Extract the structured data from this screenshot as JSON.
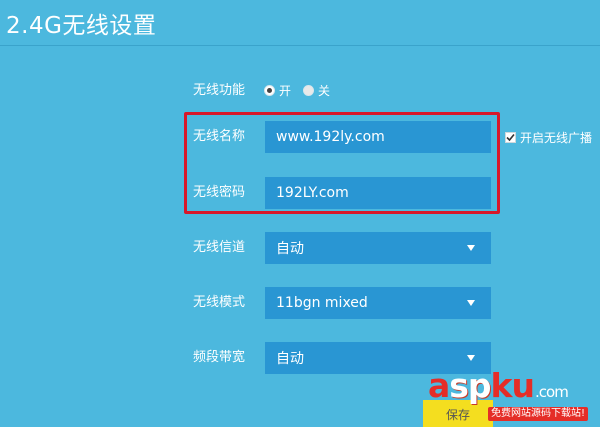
{
  "header": {
    "title": "2.4G无线设置"
  },
  "wireless_function": {
    "label": "无线功能",
    "on_label": "开",
    "off_label": "关",
    "selected": "开"
  },
  "ssid": {
    "label": "无线名称",
    "value": "www.192ly.com"
  },
  "broadcast": {
    "label": "开启无线广播",
    "checked": true
  },
  "password": {
    "label": "无线密码",
    "value": "192LY.com"
  },
  "channel": {
    "label": "无线信道",
    "value": "自动"
  },
  "mode": {
    "label": "无线模式",
    "value": "11bgn mixed"
  },
  "bandwidth": {
    "label": "频段带宽",
    "value": "自动"
  },
  "save": {
    "label": "保存"
  },
  "watermark": {
    "brand_part1": "a",
    "brand_part2": "sp",
    "brand_part3": "ku",
    "brand_suffix": ".com",
    "slogan": "免费网站源码下载站!"
  },
  "colors": {
    "background": "#4cb8de",
    "field": "#2996d3",
    "highlight_border": "#d7182a",
    "save_button": "#f4de1f"
  }
}
